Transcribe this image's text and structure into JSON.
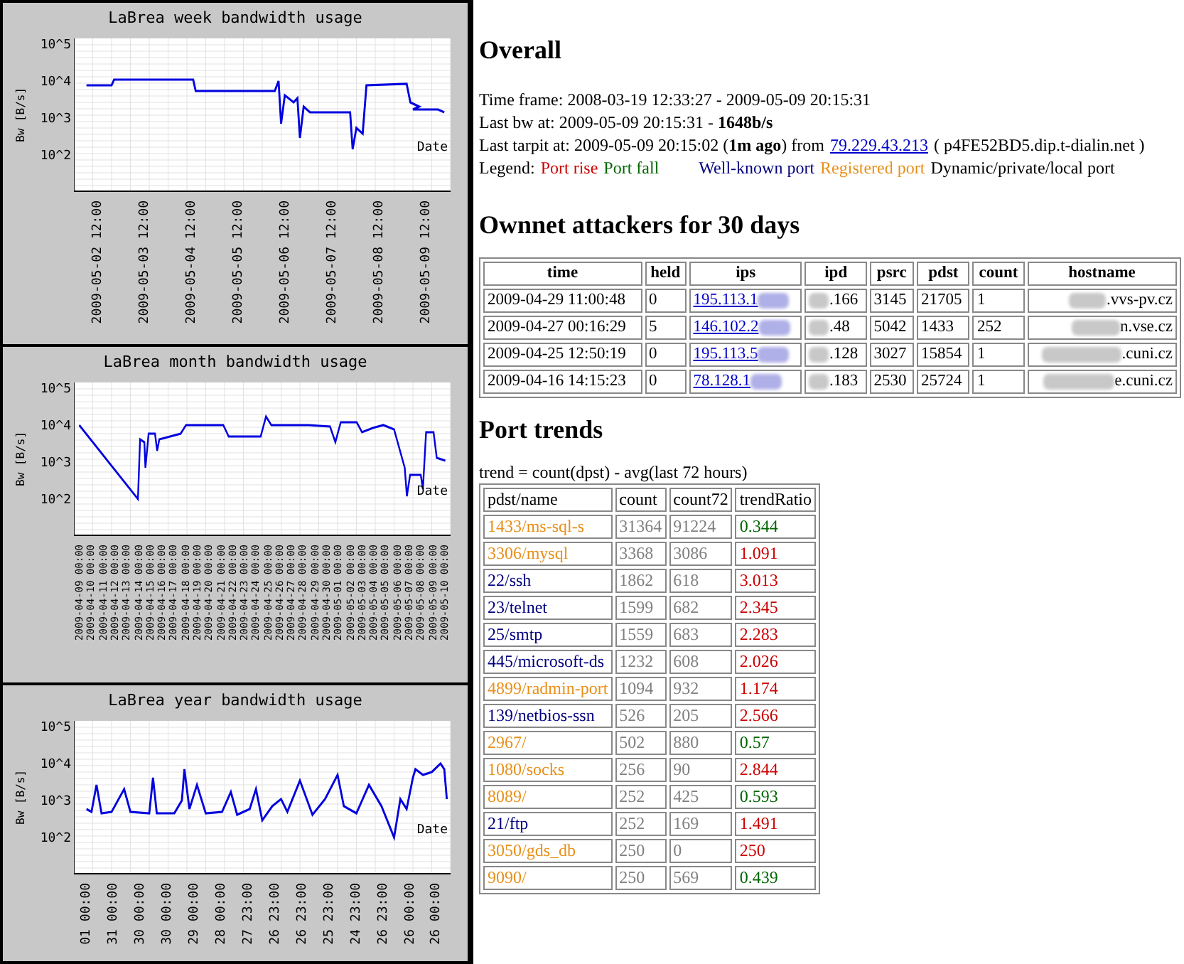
{
  "charts": [
    {
      "title": "LaBrea week bandwidth usage",
      "ylabel": "Bw [B/s]",
      "yticks": [
        "10^5",
        "10^4",
        "10^3",
        "10^2"
      ],
      "xlabel": "Date",
      "xticks": [
        "2009-05-02 12:00",
        "2009-05-03 12:00",
        "2009-05-04 12:00",
        "2009-05-05 12:00",
        "2009-05-06 12:00",
        "2009-05-07 12:00",
        "2009-05-08 12:00",
        "2009-05-09 12:00"
      ]
    },
    {
      "title": "LaBrea month bandwidth usage",
      "ylabel": "Bw [B/s]",
      "yticks": [
        "10^5",
        "10^4",
        "10^3",
        "10^2"
      ],
      "xlabel": "Date",
      "xticks": [
        "2009-04-09 00:00",
        "2009-04-10 00:00",
        "2009-04-11 00:00",
        "2009-04-12 00:00",
        "2009-04-13 00:00",
        "2009-04-14 00:00",
        "2009-04-15 00:00",
        "2009-04-16 00:00",
        "2009-04-17 00:00",
        "2009-04-18 00:00",
        "2009-04-19 00:00",
        "2009-04-20 00:00",
        "2009-04-21 00:00",
        "2009-04-22 00:00",
        "2009-04-23 00:00",
        "2009-04-24 00:00",
        "2009-04-25 00:00",
        "2009-04-26 00:00",
        "2009-04-27 00:00",
        "2009-04-28 00:00",
        "2009-04-29 00:00",
        "2009-04-30 00:00",
        "2009-05-01 00:00",
        "2009-05-02 00:00",
        "2009-05-03 00:00",
        "2009-05-04 00:00",
        "2009-05-05 00:00",
        "2009-05-06 00:00",
        "2009-05-07 00:00",
        "2009-05-08 00:00",
        "2009-05-09 00:00",
        "2009-05-10 00:00"
      ]
    },
    {
      "title": "LaBrea year bandwidth usage",
      "ylabel": "Bw [B/s]",
      "yticks": [
        "10^5",
        "10^4",
        "10^3",
        "10^2"
      ],
      "xlabel": "Date",
      "xticks": [
        "01 00:00",
        "31 00:00",
        "30 00:00",
        "30 00:00",
        "29 00:00",
        "28 00:00",
        "27 23:00",
        "26 23:00",
        "26 23:00",
        "25 23:00",
        "24 23:00",
        "26 23:00",
        "26 00:00",
        "26 00:00"
      ]
    }
  ],
  "overall": {
    "heading": "Overall",
    "time_frame": "Time frame: 2008-03-19 12:33:27 - 2009-05-09 20:15:31",
    "last_bw": "Last bw at: 2009-05-09 20:15:31 - **1648b/s**",
    "last_tarpit": "Last tarpit at: 2009-05-09 20:15:02 (**1m ago**) from",
    "tarpit_ip": "79.229.43.213",
    "tarpit_host": "( p4FE52BD5.dip.t-dialin.net )",
    "legend_label": "Legend:",
    "legend": [
      {
        "label": "Port rise",
        "color": "#cc0000"
      },
      {
        "label": "Port fall",
        "color": "#006600"
      },
      {
        "label": "Well-known port",
        "color": "#000080"
      },
      {
        "label": "Registered port",
        "color": "#e8901a"
      },
      {
        "label": "Dynamic/private/local port",
        "color": "#000000"
      }
    ]
  },
  "attackers": {
    "heading": "Ownnet attackers for 30 days",
    "columns": [
      "time",
      "held",
      "ips",
      "ipd",
      "psrc",
      "pdst",
      "count",
      "hostname"
    ],
    "rows": [
      {
        "time": "2009-04-29 11:00:48",
        "held": "0",
        "ips": "195.113.1",
        "ipd": ".166",
        "psrc": "3145",
        "pdst": "21705",
        "count": "1",
        "hostname": ".vvs-pv.cz"
      },
      {
        "time": "2009-04-27 00:16:29",
        "held": "5",
        "ips": "146.102.2",
        "ipd": ".48",
        "psrc": "5042",
        "pdst": "1433",
        "count": "252",
        "hostname": "n.vse.cz"
      },
      {
        "time": "2009-04-25 12:50:19",
        "held": "0",
        "ips": "195.113.5",
        "ipd": ".128",
        "psrc": "3027",
        "pdst": "15854",
        "count": "1",
        "hostname": ".cuni.cz"
      },
      {
        "time": "2009-04-16 14:15:23",
        "held": "0",
        "ips": "78.128.1",
        "ipd": ".183",
        "psrc": "2530",
        "pdst": "25724",
        "count": "1",
        "hostname": "e.cuni.cz"
      }
    ]
  },
  "port_trends": {
    "heading": "Port trends",
    "formula": "trend = count(dpst) - avg(last 72 hours)",
    "columns": [
      "pdst/name",
      "count",
      "count72",
      "trendRatio"
    ],
    "rows": [
      {
        "port": "1433/ms-sql-s",
        "color": "#e8901a",
        "count": "31364",
        "count72": "91224",
        "ratio": "0.344",
        "rising": false
      },
      {
        "port": "3306/mysql",
        "color": "#e8901a",
        "count": "3368",
        "count72": "3086",
        "ratio": "1.091",
        "rising": true
      },
      {
        "port": "22/ssh",
        "color": "#000080",
        "count": "1862",
        "count72": "618",
        "ratio": "3.013",
        "rising": true
      },
      {
        "port": "23/telnet",
        "color": "#000080",
        "count": "1599",
        "count72": "682",
        "ratio": "2.345",
        "rising": true
      },
      {
        "port": "25/smtp",
        "color": "#000080",
        "count": "1559",
        "count72": "683",
        "ratio": "2.283",
        "rising": true
      },
      {
        "port": "445/microsoft-ds",
        "color": "#000080",
        "count": "1232",
        "count72": "608",
        "ratio": "2.026",
        "rising": true
      },
      {
        "port": "4899/radmin-port",
        "color": "#e8901a",
        "count": "1094",
        "count72": "932",
        "ratio": "1.174",
        "rising": true
      },
      {
        "port": "139/netbios-ssn",
        "color": "#000080",
        "count": "526",
        "count72": "205",
        "ratio": "2.566",
        "rising": true
      },
      {
        "port": "2967/",
        "color": "#e8901a",
        "count": "502",
        "count72": "880",
        "ratio": "0.57",
        "rising": false
      },
      {
        "port": "1080/socks",
        "color": "#e8901a",
        "count": "256",
        "count72": "90",
        "ratio": "2.844",
        "rising": true
      },
      {
        "port": "8089/",
        "color": "#e8901a",
        "count": "252",
        "count72": "425",
        "ratio": "0.593",
        "rising": false
      },
      {
        "port": "21/ftp",
        "color": "#000080",
        "count": "252",
        "count72": "169",
        "ratio": "1.491",
        "rising": true
      },
      {
        "port": "3050/gds_db",
        "color": "#e8901a",
        "count": "250",
        "count72": "0",
        "ratio": "250",
        "rising": true
      },
      {
        "port": "9090/",
        "color": "#e8901a",
        "count": "250",
        "count72": "569",
        "ratio": "0.439",
        "rising": false
      }
    ]
  }
}
